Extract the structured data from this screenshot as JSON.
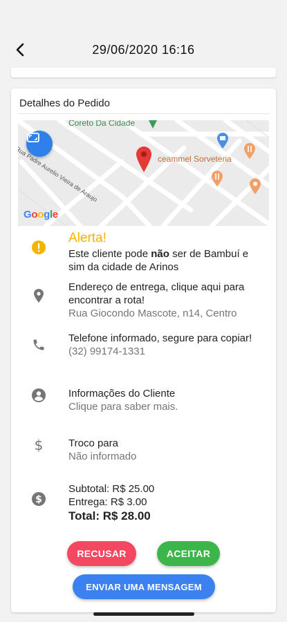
{
  "header": {
    "title": "29/06/2020 16:16",
    "back_icon": "arrow-left-icon"
  },
  "order": {
    "section_title": "Detalhes do Pedido",
    "map": {
      "labels": [
        "Coreto Da Cidade",
        "ceammel Sorveteria",
        "Rua Padre Aurelio Vieira de Araujo"
      ],
      "expand_icon": "fullscreen-icon",
      "logo_text": "Google"
    },
    "alert": {
      "title": "Alerta!",
      "text_before": "Este cliente pode ",
      "text_bold": "não",
      "text_after": " ser de Bambuí e sim da cidade de Arinos"
    },
    "address": {
      "label": "Endereço de entrega, clique aqui para encontrar a rota!",
      "value": "Rua Giocondo Mascote, n14, Centro"
    },
    "phone": {
      "label": "Telefone informado, segure para copiar!",
      "value": "(32) 99174-1331"
    },
    "client": {
      "label": "Informações do Cliente",
      "value": "Clique para saber mais."
    },
    "change": {
      "label": "Troco para",
      "value": "Não informado"
    },
    "totals": {
      "subtotal": "Subtotal: R$ 25.00",
      "delivery": "Entrega: R$ 3.00",
      "total": "Total: R$ 28.00"
    }
  },
  "actions": {
    "refuse": "RECUSAR",
    "accept": "ACEITAR",
    "message": "ENVIAR UMA MENSAGEM"
  },
  "colors": {
    "alert": "#f4b400",
    "refuse": "#f44862",
    "accept": "#3cb64a",
    "message": "#3b82f0",
    "map_pin": "#e53935"
  }
}
